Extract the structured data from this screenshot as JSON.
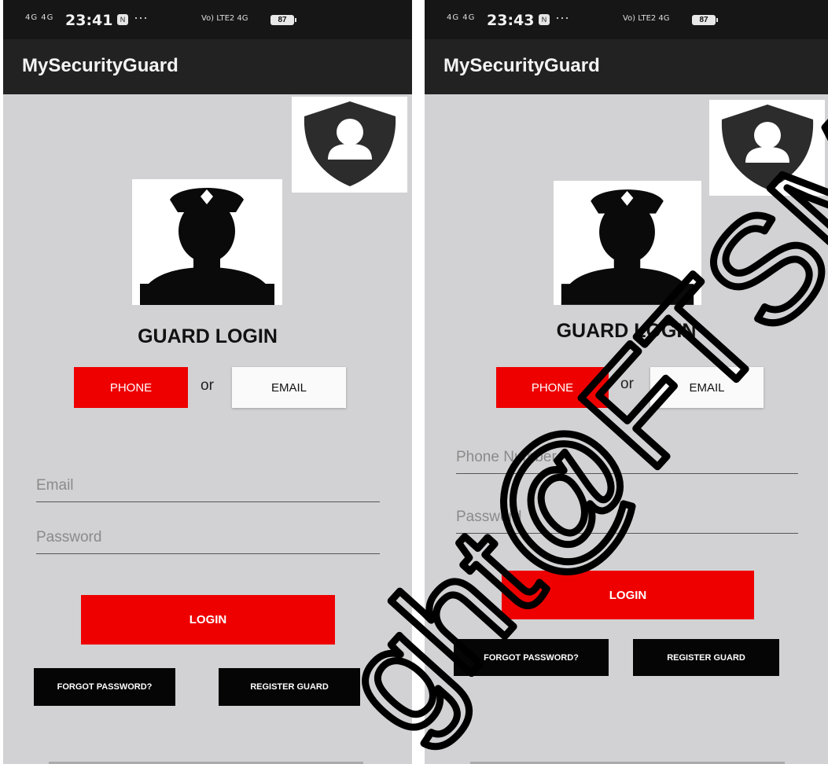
{
  "screens": [
    {
      "status": {
        "signal": "4G 4G",
        "time": "23:41",
        "notif_icon": "N",
        "more": "···",
        "network": "Vo) LTE2 4G",
        "battery": "87"
      },
      "app_title": "MySecurityGuard",
      "heading": "GUARD LOGIN",
      "tab_phone": "PHONE",
      "or_text": "or",
      "tab_email": "EMAIL",
      "selected_tab": "PHONE",
      "field1_placeholder": "Email",
      "field2_placeholder": "Password",
      "login_label": "LOGIN",
      "forgot_label": "FORGOT PASSWORD?",
      "register_label": "REGISTER GUARD"
    },
    {
      "status": {
        "signal": "4G 4G",
        "time": "23:43",
        "notif_icon": "N",
        "more": "···",
        "network": "Vo) LTE2 4G",
        "battery": "87"
      },
      "app_title": "MySecurityGuard",
      "heading": "GUARD LOGIN",
      "tab_phone": "PHONE",
      "or_text": "or",
      "tab_email": "EMAIL",
      "selected_tab": "PHONE",
      "field1_placeholder": "Phone Number",
      "field2_placeholder": "Password",
      "login_label": "LOGIN",
      "forgot_label": "FORGOT PASSWORD?",
      "register_label": "REGISTER GUARD"
    }
  ],
  "watermark": "ght@FTSM",
  "icons": {
    "badge": "shield-user-icon",
    "avatar": "security-guard-icon"
  },
  "colors": {
    "accent": "#ee0000",
    "appbar": "#222222",
    "statusbar": "#161616",
    "background": "#d2d2d4"
  }
}
